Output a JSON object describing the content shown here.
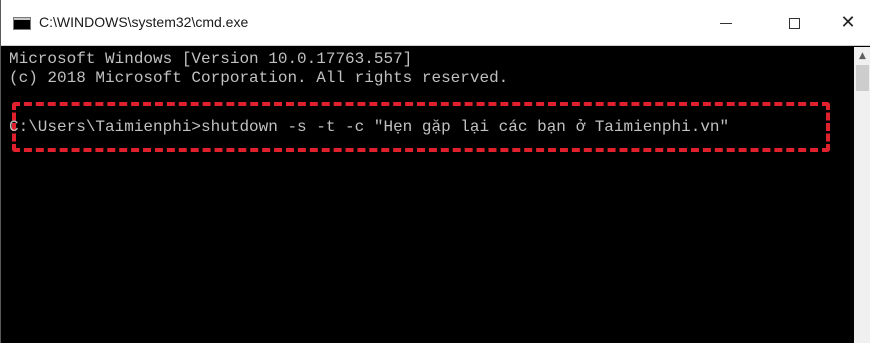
{
  "window": {
    "title": "C:\\WINDOWS\\system32\\cmd.exe",
    "icon": "cmd-icon",
    "controls": {
      "minimize_icon": "minimize-icon",
      "maximize_icon": "maximize-icon",
      "close_icon": "close-icon",
      "close_glyph": "✕"
    }
  },
  "console": {
    "lines": [
      "Microsoft Windows [Version 10.0.17763.557]",
      "(c) 2018 Microsoft Corporation. All rights reserved.",
      "C:\\Users\\Taimienphi>shutdown -s -t -c \"Hẹn gặp lại các bạn ở Taimienphi.vn\""
    ]
  },
  "scrollbar": {
    "up_arrow": "▲"
  },
  "colors": {
    "console_bg": "#000000",
    "console_text": "#c0c0c0",
    "highlight": "#e0202c"
  }
}
